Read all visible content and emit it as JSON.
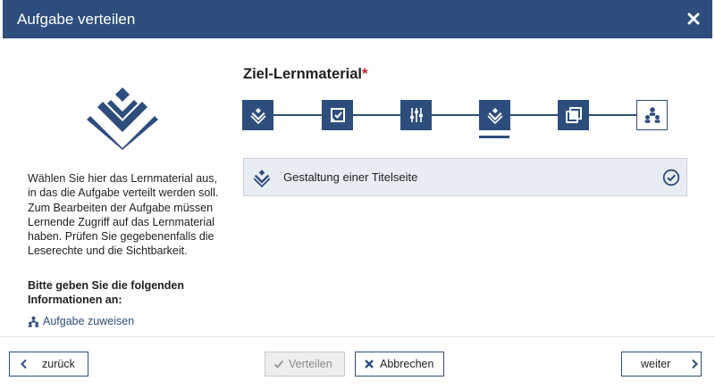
{
  "window": {
    "title": "Aufgabe verteilen",
    "close_icon": "close-icon"
  },
  "left_panel": {
    "logo_icon": "stacked-layers-logo-icon",
    "description": "Wählen Sie hier das Lernmaterial aus, in das die Aufgabe verteilt werden soll. Zum Bearbeiten der Aufgabe müssen Lernende Zugriff auf das Lernmaterial haben. Prüfen Sie gegebenenfalls die Leserechte und die Sichtbarkeit.",
    "required_info_heading": "Bitte geben Sie die folgenden Informationen an:",
    "required_items": [
      {
        "label": "Aufgabe zuweisen",
        "icon": "users-icon"
      }
    ]
  },
  "main": {
    "section_title": "Ziel-Lernmaterial",
    "required_marker": "*",
    "steps": [
      {
        "icon": "layers-icon",
        "active": false,
        "outline": false
      },
      {
        "icon": "checkbox-edit-icon",
        "active": false,
        "outline": false
      },
      {
        "icon": "sliders-icon",
        "active": false,
        "outline": false
      },
      {
        "icon": "layers-icon",
        "active": true,
        "outline": false
      },
      {
        "icon": "copy-icon",
        "active": false,
        "outline": false
      },
      {
        "icon": "users-icon",
        "active": false,
        "outline": true
      }
    ],
    "selected_material": {
      "label": "Gestaltung einer Titelseite",
      "icon": "layers-icon",
      "status_icon": "check-circle-icon"
    }
  },
  "footer": {
    "back_label": "zurück",
    "submit_label": "Verteilen",
    "submit_enabled": false,
    "cancel_label": "Abbrechen",
    "next_label": "weiter"
  },
  "colors": {
    "primary": "#2d4e7c",
    "required": "#c0202a",
    "selected_bg": "#e8ecf3",
    "disabled_bg": "#eeeeee"
  }
}
